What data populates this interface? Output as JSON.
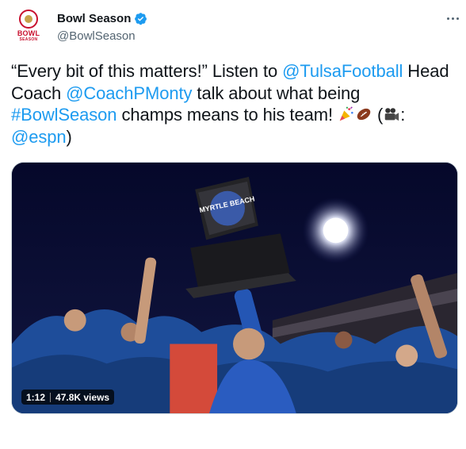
{
  "account": {
    "display_name": "Bowl Season",
    "handle": "@BowlSeason",
    "avatar_text_top": "BOWL",
    "avatar_text_bottom": "SEASON"
  },
  "tweet": {
    "segments": [
      {
        "type": "text",
        "value": "“Every bit of this matters!” Listen to "
      },
      {
        "type": "mention",
        "value": "@TulsaFootball"
      },
      {
        "type": "text",
        "value": " Head Coach "
      },
      {
        "type": "mention",
        "value": "@CoachPMonty"
      },
      {
        "type": "text",
        "value": " talk about what being "
      },
      {
        "type": "hashtag",
        "value": "#BowlSeason"
      },
      {
        "type": "text",
        "value": " champs means to his team! "
      },
      {
        "type": "emoji",
        "value": "party-popper-icon"
      },
      {
        "type": "emoji",
        "value": "football-icon"
      },
      {
        "type": "text",
        "value": " ("
      },
      {
        "type": "emoji",
        "value": "movie-camera-icon"
      },
      {
        "type": "text",
        "value": ": "
      },
      {
        "type": "mention",
        "value": "@espn"
      },
      {
        "type": "text",
        "value": ")"
      }
    ],
    "link_color": "#1d9bf0"
  },
  "video": {
    "duration": "1:12",
    "views": "47.8K views",
    "trophy_text": "MYRTLE BEACH"
  },
  "colors": {
    "verified": "#1d9bf0",
    "brand_red": "#c8102e",
    "text": "#0f1419",
    "secondary": "#536471"
  }
}
